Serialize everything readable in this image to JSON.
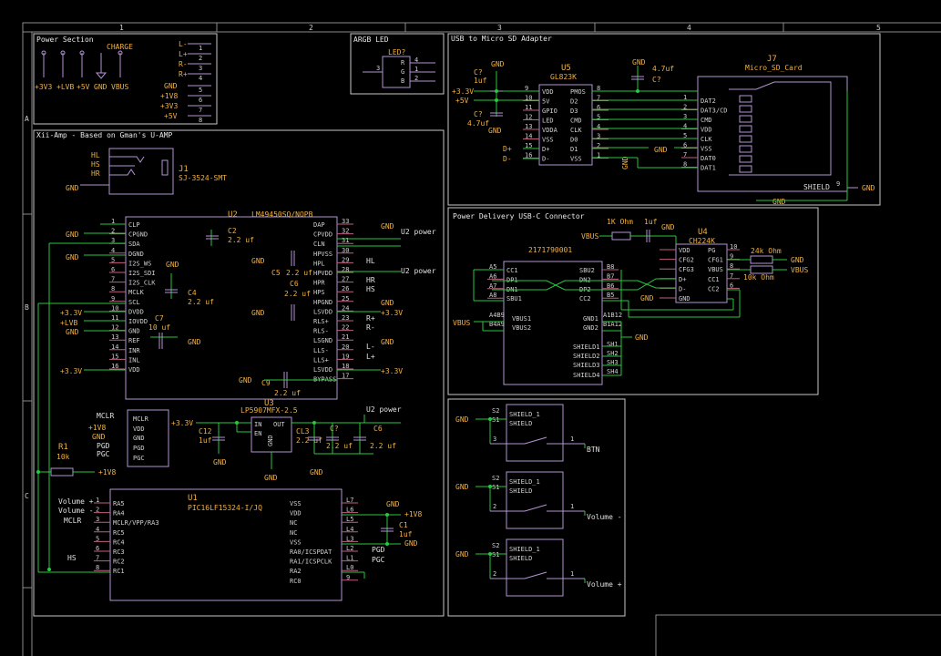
{
  "grid": {
    "cols": [
      "1",
      "2",
      "3",
      "4",
      "5"
    ],
    "rows": [
      "A",
      "B",
      "C"
    ]
  },
  "sections": {
    "power": "Power Section",
    "argb": "ARGB LED",
    "usb_sd": "USB to Micro SD Adapter",
    "amp": "Xii-Amp - Based on Gman's U-AMP",
    "pd": "Power Delivery USB-C Connector"
  },
  "power_section": {
    "charge": "CHARGE",
    "rails": [
      "+3V3",
      "+LVB",
      "+5V",
      "GND",
      "VBUS"
    ],
    "connector_left": [
      "L-",
      "L+",
      "R-",
      "R+",
      "GND",
      "+1V8",
      "+3V3",
      "+5V"
    ],
    "connector_pins": [
      "1",
      "2",
      "3",
      "4",
      "5",
      "6",
      "7",
      "8"
    ],
    "connector_right": [
      "L",
      "L",
      "L",
      "L",
      "L",
      "L",
      "L",
      "L"
    ]
  },
  "argb": {
    "ref": "LED?",
    "pins": [
      "R",
      "G",
      "B"
    ],
    "pin_nums": [
      "4",
      "1",
      "2",
      "3"
    ]
  },
  "usb_sd": {
    "u5_ref": "U5",
    "u5_val": "GL823K",
    "u5_left": [
      "VDD",
      "5V",
      "GPIO",
      "LED",
      "VDDA",
      "VSS",
      "D+",
      "D-"
    ],
    "u5_left_nums": [
      "9",
      "10",
      "11",
      "12",
      "13",
      "14",
      "15",
      "16"
    ],
    "u5_right": [
      "PMOS",
      "D2",
      "D3",
      "CMD",
      "CLK",
      "D0",
      "D1",
      "VSS"
    ],
    "u5_right_nums": [
      "8",
      "7",
      "6",
      "5",
      "4",
      "3",
      "2",
      "1"
    ],
    "j7_ref": "J7",
    "j7_val": "Micro_SD_Card",
    "j7_pins": [
      "DAT2",
      "DAT3/CD",
      "CMD",
      "VDD",
      "CLK",
      "VSS",
      "DAT0",
      "DAT1"
    ],
    "j7_nums": [
      "1",
      "2",
      "3",
      "4",
      "5",
      "6",
      "7",
      "8"
    ],
    "shield": "SHIELD",
    "shield_num": "9",
    "c7a": "C?",
    "c7a_val": "1uf",
    "c7b": "C?",
    "c7b_val": "4.7uf",
    "c_top": "4.7uf",
    "c_top_ref": "C?",
    "pwr_left": [
      "+3.3V",
      "+5V"
    ],
    "dp": "D+",
    "dm": "D-",
    "gnd": "GND"
  },
  "amp": {
    "jack_ref": "J1",
    "jack_val": "SJ-3524-SMT",
    "jack_pins": [
      "HL",
      "HS",
      "HR"
    ],
    "u2_ref": "U2",
    "u2_val": "LM49450SQ/NOPB",
    "u2_left": [
      "CLP",
      "CPGND",
      "SDA",
      "DGND",
      "I2S_WS",
      "I2S_SDI",
      "I2S_CLK",
      "MCLK",
      "SCL",
      "DVDD",
      "IOVDD",
      "GND",
      "REF",
      "INR",
      "INL",
      "VDD"
    ],
    "u2_left_nums": [
      "1",
      "2",
      "3",
      "4",
      "5",
      "6",
      "7",
      "8",
      "9",
      "10",
      "11",
      "12",
      "13",
      "14",
      "15",
      "16"
    ],
    "u2_right": [
      "DAP",
      "CPVDD",
      "CLN",
      "HPVSS",
      "HPL",
      "HPVDD",
      "HPR",
      "HPS",
      "HPGND",
      "LSVDD",
      "RLS+",
      "RLS-",
      "LSGND",
      "LLS-",
      "LLS+",
      "LSVDD",
      "BYPASS"
    ],
    "u2_right_nums": [
      "33",
      "32",
      "31",
      "30",
      "29",
      "28",
      "27",
      "26",
      "25",
      "24",
      "23",
      "22",
      "21",
      "20",
      "19",
      "18",
      "17"
    ],
    "c2": "C2",
    "c2_val": "2.2 uf",
    "c5": "C5",
    "c5_val": "2.2 uf",
    "c6": "C6",
    "c6_val": "2.2 uf",
    "c4": "C4",
    "c4_val": "2.2 uf",
    "c7": "C7",
    "c7_val": "10 uf",
    "c9": "C9",
    "c9_val": "2.2 uf",
    "u2_power": "U2 power",
    "right_nets": [
      "HL",
      "HR",
      "HS",
      "R+",
      "R-",
      "L-",
      "L+"
    ],
    "left_pwr": [
      "+3.3V",
      "+LVB",
      "GND",
      "+3.3V"
    ],
    "u3_ref": "U3",
    "u3_val": "LP5907MFX-2.5",
    "u3_pins": [
      "IN",
      "EN",
      "OUT",
      "GND"
    ],
    "c12": "C12",
    "c12_val": "1uf",
    "c13": "CL3",
    "c13_val": "2.2 uf",
    "c6b": "C6",
    "c6b_val": "2.2 uf",
    "c_mid": "C?",
    "prog_pins": [
      "MCLR",
      "VDD",
      "GND",
      "PGD",
      "PGC"
    ],
    "prog_left": [
      "MCLR",
      "+1V8",
      "GND",
      "PGD",
      "PGC"
    ],
    "r1_ref": "R1",
    "r1_val": "10k",
    "plus_1v8": "+1V8",
    "u1_ref": "U1",
    "u1_val": "PIC16LF15324-I/JQ",
    "u1_left": [
      "RA5",
      "RA4",
      "MCLR/VPP/RA3",
      "RC5",
      "RC4",
      "RC3",
      "RC2",
      "RC1"
    ],
    "u1_left_nums": [
      "1",
      "2",
      "3",
      "4",
      "5",
      "6",
      "7",
      "8"
    ],
    "u1_right": [
      "VSS",
      "VDD",
      "NC",
      "NC",
      "VSS",
      "RA0/ICSPDAT",
      "RA1/ICSPCLK",
      "RA2",
      "RC0"
    ],
    "u1_right_nums": [
      "L7",
      "L6",
      "L5",
      "L4",
      "L3",
      "L2",
      "L1",
      "L0",
      "9"
    ],
    "u1_left_nets": [
      "Volume +",
      "Volume -",
      "MCLR",
      "HS"
    ],
    "c1": "C1",
    "c1_val": "1uf",
    "pgd": "PGD",
    "pgc": "PGC"
  },
  "pd": {
    "j_val": "2171790001",
    "left_pins": [
      "CC1",
      "DP1",
      "DN1",
      "SBU1"
    ],
    "left_nums": [
      "A5",
      "A6",
      "A7",
      "A8"
    ],
    "right_pins": [
      "SBU2",
      "DN2",
      "DP2",
      "CC2"
    ],
    "right_nums": [
      "B8",
      "B7",
      "B6",
      "B5"
    ],
    "vbus": [
      "VBUS1",
      "VBUS2"
    ],
    "vbus_nums": [
      "A4B9",
      "B4A9"
    ],
    "gnd_pins": [
      "GND1",
      "GND2"
    ],
    "gnd_nums": [
      "A1B12",
      "B1A12"
    ],
    "shields": [
      "SHIELD1",
      "SHIELD2",
      "SHIELD3",
      "SHIELD4"
    ],
    "shield_nums": [
      "SH1",
      "SH2",
      "SH3",
      "SH4"
    ],
    "u4_ref": "U4",
    "u4_val": "CH224K",
    "u4_left": [
      "VDD",
      "CFG2",
      "CFG3",
      "D+",
      "D-",
      "GND"
    ],
    "u4_right": [
      "PG",
      "CFG1",
      "VBUS",
      "CC1",
      "CC2"
    ],
    "u4_right_nums": [
      "10",
      "9",
      "8",
      "7",
      "6"
    ],
    "r_val": "1K Ohm",
    "c_val": "1uf",
    "r24k": "24k Ohm",
    "r10k": "10k Ohm",
    "vbus_label": "VBUS",
    "gnd": "GND"
  },
  "buttons": [
    {
      "sw": "SHIELD_1",
      "sh": "SHIELD",
      "nums": [
        "S2",
        "S1"
      ],
      "pin": "3",
      "pin2": "1",
      "net": "BTN"
    },
    {
      "sw": "SHIELD_1",
      "sh": "SHIELD",
      "nums": [
        "S2",
        "S1"
      ],
      "pin": "2",
      "pin2": "1",
      "net": "Volume -"
    },
    {
      "sw": "SHIELD_1",
      "sh": "SHIELD",
      "nums": [
        "S2",
        "S1"
      ],
      "pin": "2",
      "pin2": "1",
      "net": "Volume +"
    }
  ],
  "colors": {
    "background": "#000000",
    "wire": "#27c93f",
    "part": "#b494d4",
    "power": "#f0b040"
  }
}
